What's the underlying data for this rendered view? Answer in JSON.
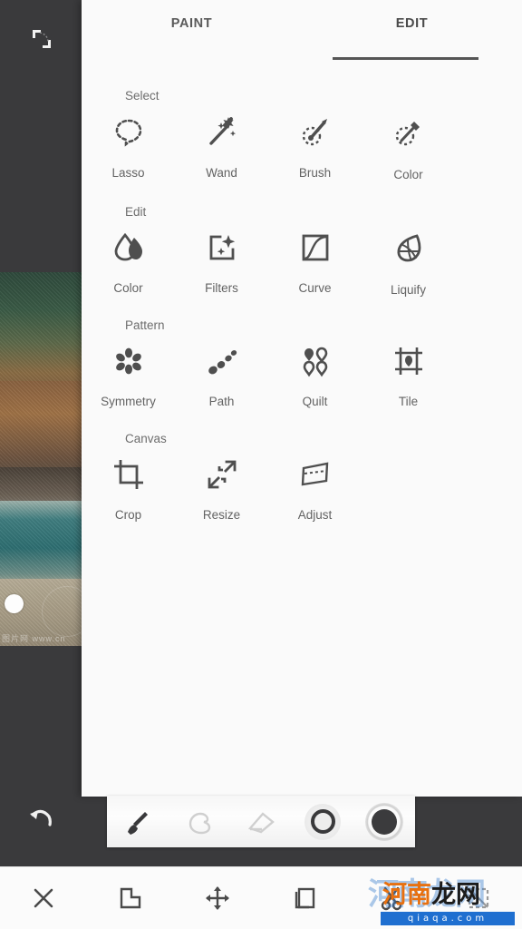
{
  "app": {
    "background_color": "#3a3a3c",
    "panel_color": "#fafafa",
    "accent_color": "#555555"
  },
  "canvas": {
    "collapse_icon": "collapse-arrows-icon",
    "undo_icon": "undo-icon",
    "handle": "canvas-resize-handle",
    "image_watermark": "图片网 www.cn"
  },
  "panel": {
    "tabs": [
      {
        "label": "PAINT",
        "active": false
      },
      {
        "label": "EDIT",
        "active": true
      }
    ],
    "sections": [
      {
        "title": "Select",
        "items": [
          {
            "label": "Lasso",
            "icon": "lasso-icon"
          },
          {
            "label": "Wand",
            "icon": "magic-wand-icon"
          },
          {
            "label": "Brush",
            "icon": "selection-brush-icon"
          },
          {
            "label": "Color",
            "icon": "color-picker-select-icon"
          }
        ]
      },
      {
        "title": "Edit",
        "items": [
          {
            "label": "Color",
            "icon": "droplets-icon"
          },
          {
            "label": "Filters",
            "icon": "filters-sparkle-icon"
          },
          {
            "label": "Curve",
            "icon": "curve-icon"
          },
          {
            "label": "Liquify",
            "icon": "liquify-icon"
          }
        ]
      },
      {
        "title": "Pattern",
        "items": [
          {
            "label": "Symmetry",
            "icon": "symmetry-icon"
          },
          {
            "label": "Path",
            "icon": "path-icon"
          },
          {
            "label": "Quilt",
            "icon": "quilt-icon"
          },
          {
            "label": "Tile",
            "icon": "tile-icon"
          }
        ]
      },
      {
        "title": "Canvas",
        "items": [
          {
            "label": "Crop",
            "icon": "crop-icon"
          },
          {
            "label": "Resize",
            "icon": "resize-icon"
          },
          {
            "label": "Adjust",
            "icon": "adjust-perspective-icon"
          }
        ]
      }
    ]
  },
  "brush_toolbar": {
    "items": [
      {
        "name": "brush-tool",
        "icon": "paintbrush-icon",
        "selected": false
      },
      {
        "name": "smudge-tool",
        "icon": "smudge-hand-icon",
        "selected": false
      },
      {
        "name": "eraser-tool",
        "icon": "eraser-icon",
        "selected": false
      },
      {
        "name": "brush-size",
        "icon": "size-ring-icon",
        "selected": false
      },
      {
        "name": "color-swatch",
        "icon": "color-swatch-icon",
        "color": "#3b3b3d"
      }
    ]
  },
  "bottom_bar": {
    "items": [
      {
        "name": "close",
        "icon": "close-x-icon"
      },
      {
        "name": "merge-shape",
        "icon": "shape-combine-icon"
      },
      {
        "name": "move",
        "icon": "move-arrows-icon"
      },
      {
        "name": "duplicate",
        "icon": "duplicate-icon"
      },
      {
        "name": "cut",
        "icon": "scissors-icon"
      },
      {
        "name": "select-all",
        "icon": "marquee-select-icon"
      }
    ]
  },
  "watermark": {
    "text_orange": "河南",
    "text_black": "龙网",
    "url": "qiaqa.com",
    "ghost_text": "河南龙网"
  }
}
